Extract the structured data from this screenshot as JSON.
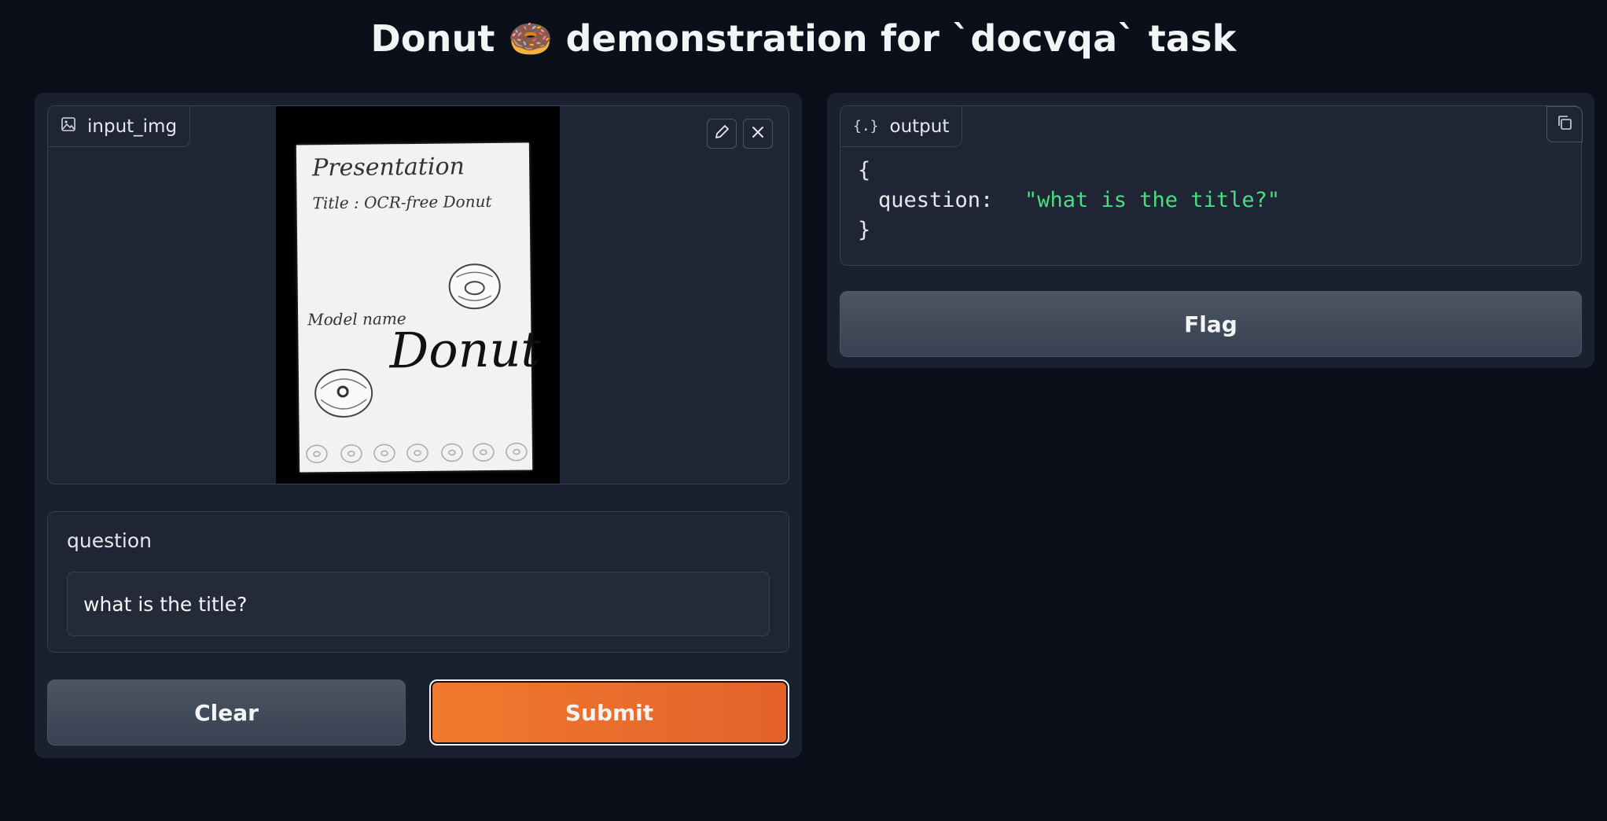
{
  "page_title": "Donut 🍩 demonstration for `docvqa` task",
  "input_image": {
    "label": "input_img",
    "icons": [
      "image-icon",
      "edit-icon",
      "close-icon"
    ],
    "document": {
      "heading": "Presentation",
      "title_line": "Title : OCR-free Donut",
      "model_label": "Model  name",
      "model_name": "Donut"
    }
  },
  "question": {
    "label": "question",
    "value": "what is the title?"
  },
  "actions": {
    "clear_label": "Clear",
    "submit_label": "Submit",
    "flag_label": "Flag"
  },
  "output": {
    "label": "output",
    "icons": [
      "json-icon",
      "copy-icon"
    ],
    "open_brace": "{",
    "key": "question:",
    "value": "\"what is the title?\"",
    "close_brace": "}"
  },
  "colors": {
    "background": "#0b0f19",
    "panel": "#1a2030",
    "primary": "#ea6b2d",
    "json_string": "#4ade80"
  }
}
